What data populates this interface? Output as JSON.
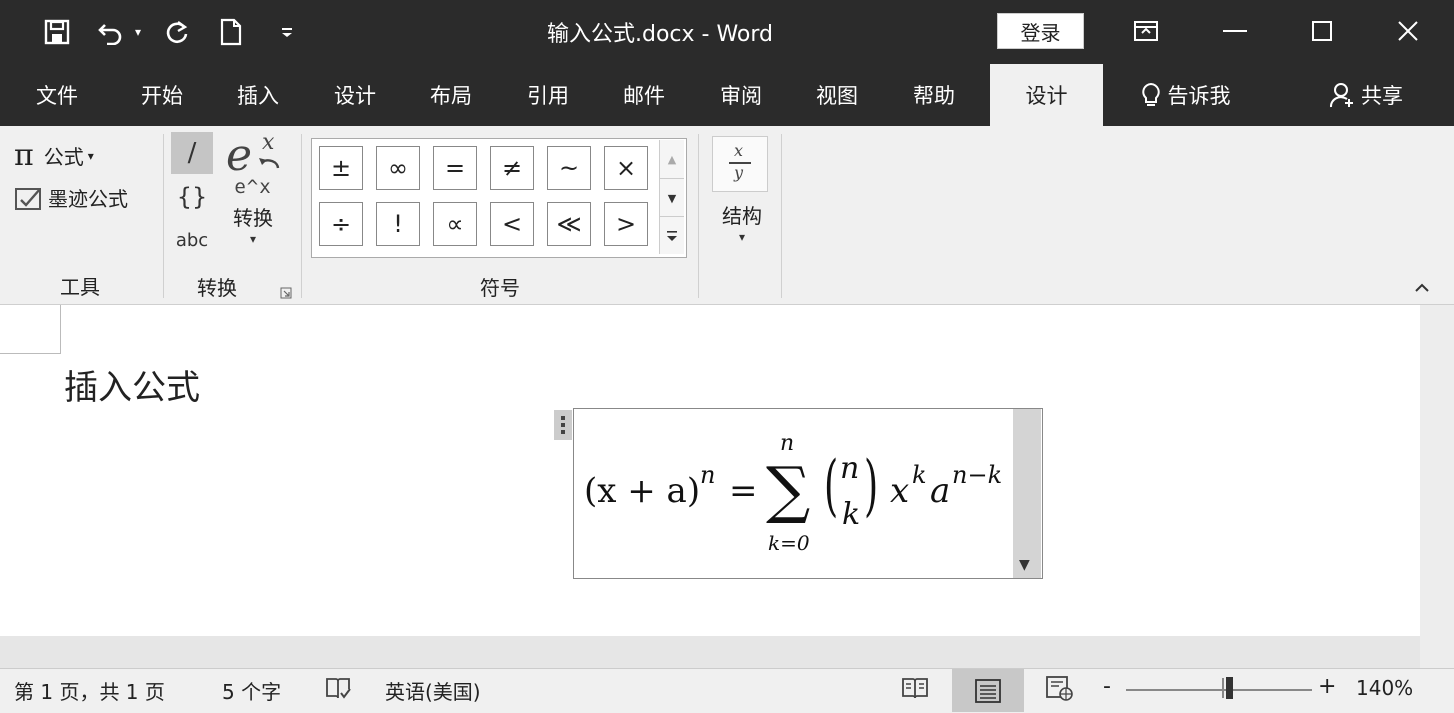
{
  "window": {
    "title": "输入公式.docx  -  Word",
    "login_label": "登录"
  },
  "tabs": [
    "文件",
    "开始",
    "插入",
    "设计",
    "布局",
    "引用",
    "邮件",
    "审阅",
    "视图",
    "帮助",
    "设计"
  ],
  "tell_me": "告诉我",
  "share": "共享",
  "ribbon": {
    "tools": {
      "equation_label": "公式",
      "ink_equation_label": "墨迹公式",
      "group_label": "工具"
    },
    "conversions": {
      "professional": "/",
      "linear": "{}",
      "normal_text": "abc",
      "convert_label": "转换",
      "convert_caption": "e^x",
      "group_label": "转换"
    },
    "symbols": {
      "row1": [
        "±",
        "∞",
        "=",
        "≠",
        "~",
        "×"
      ],
      "row2": [
        "÷",
        "!",
        "∝",
        "<",
        "≪",
        ">"
      ],
      "group_label": "符号"
    },
    "structures": {
      "label": "结构"
    }
  },
  "document": {
    "heading": "插入公式",
    "equation": {
      "lhs_base": "(x + a)",
      "lhs_exp": "n",
      "equals": "=",
      "sum_upper": "n",
      "sum_lower": "k=0",
      "binom_top": "n",
      "binom_bottom": "k",
      "x_base": "x",
      "x_exp": "k",
      "a_base": "a",
      "a_exp": "n−k"
    }
  },
  "status": {
    "page": "第 1 页，共 1 页",
    "words": "5 个字",
    "language": "英语(美国)",
    "zoom": "140%",
    "zoom_minus": "-",
    "zoom_plus": "+"
  }
}
